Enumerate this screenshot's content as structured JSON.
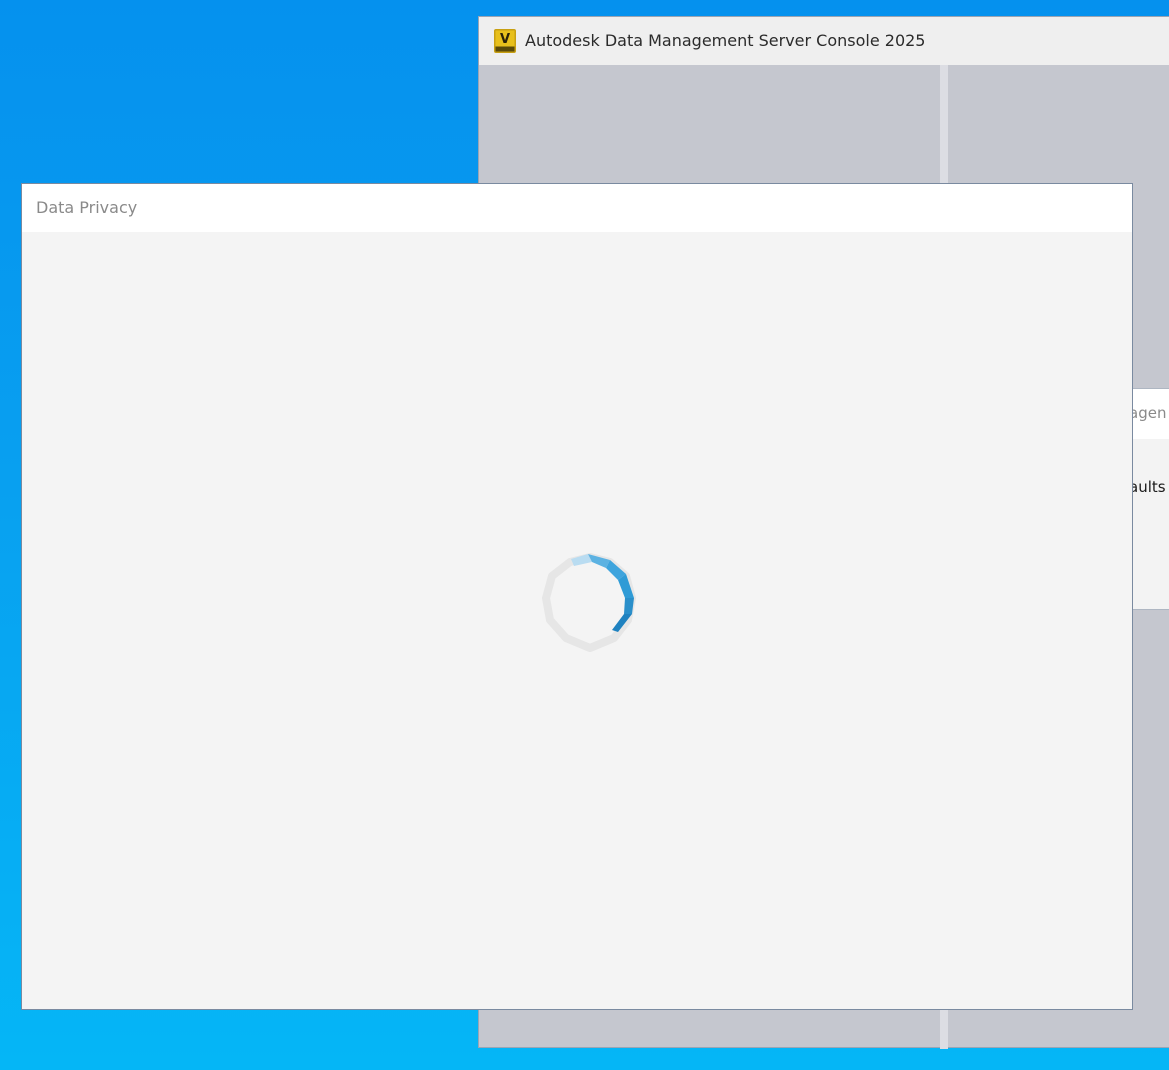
{
  "desktop": {
    "background_color": "#07a3f0"
  },
  "main_window": {
    "title": "Autodesk Data Management Server Console 2025",
    "icon": "vault-app-icon",
    "icon_letter": "V"
  },
  "behind_dialog": {
    "title_fragment": "agen",
    "body_fragment": "aults"
  },
  "privacy_dialog": {
    "title": "Data Privacy",
    "status": "loading",
    "spinner_icon": "loading-spinner-icon",
    "accent_color": "#2f9bd6"
  }
}
